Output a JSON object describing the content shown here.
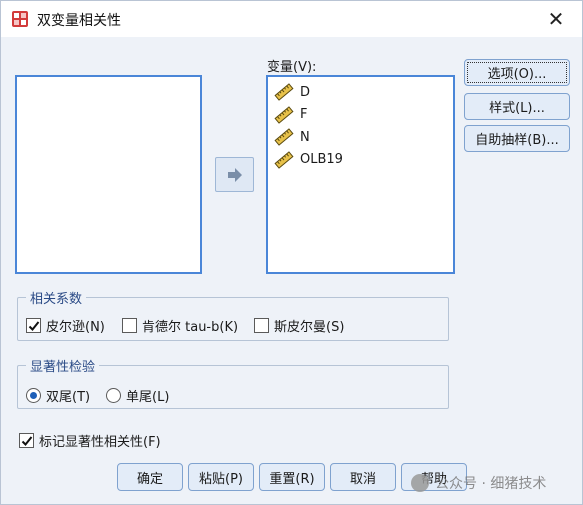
{
  "window": {
    "title": "双变量相关性",
    "close_symbol": "✕"
  },
  "variables": {
    "label": "变量(V):",
    "items": [
      {
        "name": "D",
        "icon": "scale-ruler-icon"
      },
      {
        "name": "F",
        "icon": "scale-ruler-icon"
      },
      {
        "name": "N",
        "icon": "scale-ruler-icon"
      },
      {
        "name": "OLB19",
        "icon": "scale-ruler-icon"
      }
    ]
  },
  "side_buttons": {
    "options": "选项(O)...",
    "style": "样式(L)...",
    "bootstrap": "自助抽样(B)..."
  },
  "correlation": {
    "title": "相关系数",
    "pearson": {
      "label": "皮尔逊(N)",
      "checked": true
    },
    "kendall": {
      "label": "肯德尔 tau-b(K)",
      "checked": false
    },
    "spearman": {
      "label": "斯皮尔曼(S)",
      "checked": false
    }
  },
  "significance": {
    "title": "显著性检验",
    "two_tailed": {
      "label": "双尾(T)",
      "selected": true
    },
    "one_tailed": {
      "label": "单尾(L)",
      "selected": false
    }
  },
  "flag": {
    "label": "标记显著性相关性(F)",
    "checked": true
  },
  "bottom_buttons": {
    "ok": "确定",
    "paste": "粘贴(P)",
    "reset": "重置(R)",
    "cancel": "取消",
    "help": "帮助"
  },
  "watermark": "公众号 · 细猪技术",
  "colors": {
    "accent": "#4a86d8",
    "button_border": "#7fa2cf",
    "group_title": "#2a4a86"
  }
}
